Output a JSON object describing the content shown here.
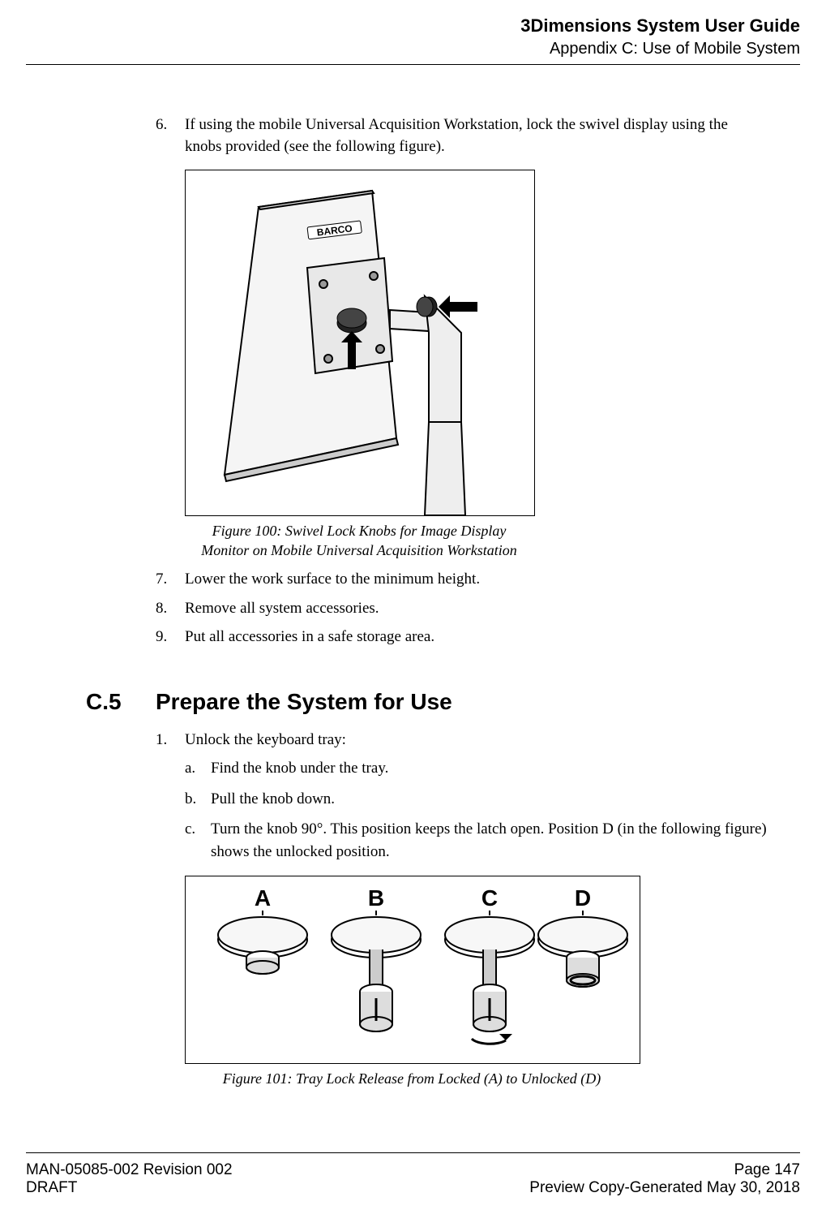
{
  "header": {
    "title": "3Dimensions System User Guide",
    "subtitle": "Appendix C: Use of Mobile System"
  },
  "steps_a": [
    {
      "n": "6.",
      "text": "If using the mobile Universal Acquisition Workstation, lock the swivel display using the knobs provided (see the following figure)."
    }
  ],
  "figure1": {
    "caption_l1": "Figure 100: Swivel Lock Knobs for Image Display",
    "caption_l2": "Monitor on Mobile Universal Acquisition Workstation",
    "brand": "BARCO"
  },
  "steps_b": [
    {
      "n": "7.",
      "text": "Lower the work surface to the minimum height."
    },
    {
      "n": "8.",
      "text": "Remove all system accessories."
    },
    {
      "n": "9.",
      "text": "Put all accessories in a safe storage area."
    }
  ],
  "section": {
    "num": "C.5",
    "title": "Prepare the System for Use"
  },
  "steps_c": [
    {
      "n": "1.",
      "text": "Unlock the keyboard tray:"
    }
  ],
  "substeps": [
    {
      "n": "a.",
      "text": "Find the knob under the tray."
    },
    {
      "n": "b.",
      "text": "Pull the knob down."
    },
    {
      "n": "c.",
      "text": "Turn the knob 90°. This position keeps the latch open. Position D (in the following figure) shows the unlocked position."
    }
  ],
  "figure2": {
    "labels": [
      "A",
      "B",
      "C",
      "D"
    ],
    "caption": "Figure 101: Tray Lock Release from Locked (A) to Unlocked (D)"
  },
  "footer": {
    "left1": "MAN-05085-002 Revision 002",
    "left2": "DRAFT",
    "right1": "Page 147",
    "right2": "Preview Copy-Generated May 30, 2018"
  }
}
